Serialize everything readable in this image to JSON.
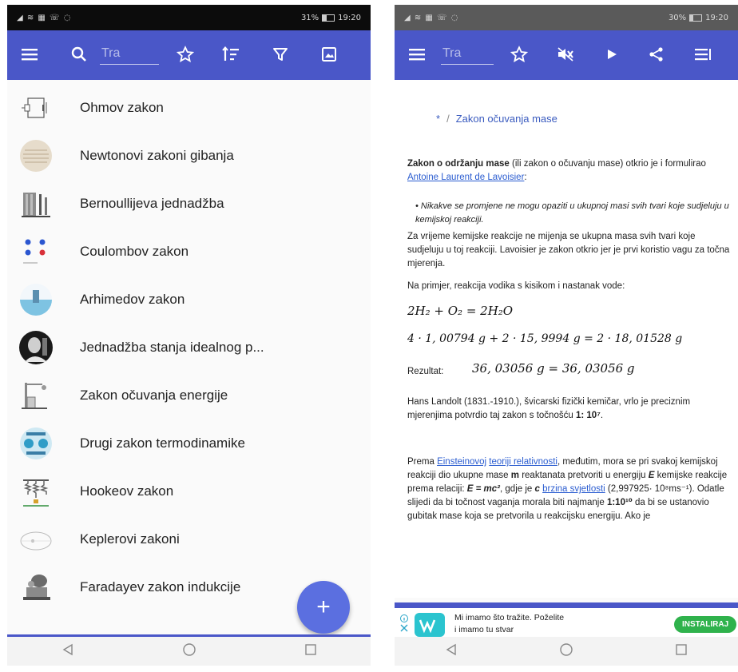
{
  "left_screen": {
    "status": {
      "icons": "◢ ≋ ▦ ☏ ◌",
      "battery": "31%",
      "time": "19:20"
    },
    "search": {
      "placeholder": "Tra"
    },
    "list_items": [
      {
        "label": "Ohmov zakon",
        "thumb": "circuit-diagram"
      },
      {
        "label": "Newtonovi zakoni gibanja",
        "thumb": "manuscript-page"
      },
      {
        "label": "Bernoullijeva jednadžba",
        "thumb": "fluid-tubes"
      },
      {
        "label": "Coulombov zakon",
        "thumb": "charges"
      },
      {
        "label": "Arhimedov zakon",
        "thumb": "water-tank"
      },
      {
        "label": "Jednadžba stanja idealnog p...",
        "thumb": "portrait"
      },
      {
        "label": "Zakon očuvanja energije",
        "thumb": "pendulum"
      },
      {
        "label": "Drugi zakon termodinamike",
        "thumb": "heat-engine"
      },
      {
        "label": "Hookeov zakon",
        "thumb": "springs"
      },
      {
        "label": "Keplerovi zakoni",
        "thumb": "orbit"
      },
      {
        "label": "Faradayev zakon indukcije",
        "thumb": "coil-device"
      }
    ],
    "fab_label": "+"
  },
  "right_screen": {
    "status": {
      "icons": "◢ ≋ ▦ ☏ ◌",
      "battery": "30%",
      "time": "19:20"
    },
    "search": {
      "placeholder": "Tra"
    },
    "breadcrumb": {
      "home": "*",
      "separator": "/",
      "current": "Zakon očuvanja mase"
    },
    "article": {
      "p1_bold": "Zakon o održanju mase",
      "p1_text": " (ili zakon o očuvanju mase) otkrio je i formulirao ",
      "p1_link": "Antoine Laurent de Lavoisier",
      "p1_end": ":",
      "quote": "Nikakve se promjene ne mogu opaziti u ukupnoj masi svih tvari koje sudjeluju u kemijskoj reakciji.",
      "p2": "Za vrijeme kemijske reakcije ne mijenja se ukupna masa svih tvari koje sudjeluju u toj reakciji. Lavoisier je zakon otkrio jer je prvi koristio vagu za točna mjerenja.",
      "p3": "Na primjer, reakcija vodika s kisikom i nastanak vode:",
      "formula1": "2H₂ + O₂ = 2H₂O",
      "formula2": "4 · 1, 00794 g  + 2 · 15, 9994 g  = 2 · 18, 01528 g",
      "result_label": "Rezultat:",
      "result_formula": "36, 03056 g = 36, 03056 g",
      "p4_text": "Hans Landolt (1831.-1910.), švicarski fizički kemičar, vrlo je preciznim mjerenjima potvrdio taj zakon s točnošću ",
      "p4_bold": "1: 10⁷",
      "p4_end": ".",
      "p5_a": "Prema ",
      "p5_link1": "Einsteinovoj",
      "p5_link2": "teoriji relativnosti",
      "p5_b": ", međutim, mora se pri svakoj kemijskoj reakciji dio ukupne mase ",
      "p5_m": "m",
      "p5_c": " reaktanata pretvoriti u energiju ",
      "p5_E": "E",
      "p5_d": " kemijske reakcije prema relaciji: ",
      "p5_eq": "E = mc²",
      "p5_e": ", gdje je ",
      "p5_c_var": "c",
      "p5_link3": "brzina svjetlosti",
      "p5_f": " (2,997925· 10⁸ms⁻¹). Odatle slijedi da bi točnost vaganja morala biti najmanje ",
      "p5_ratio": "1:10¹⁰",
      "p5_g": " da bi se ustanovio gubitak mase koja se pretvorila u reakcijsku energiju. Ako je"
    },
    "ad": {
      "line1": "Mi imamo što tražite. Poželite",
      "line2": "i imamo tu stvar",
      "button": "INSTALIRAJ"
    }
  },
  "colors": {
    "toolbar": "#4a57c8",
    "fab": "#5b6fe0",
    "link": "#2a5cd0",
    "install": "#2fb24c"
  }
}
